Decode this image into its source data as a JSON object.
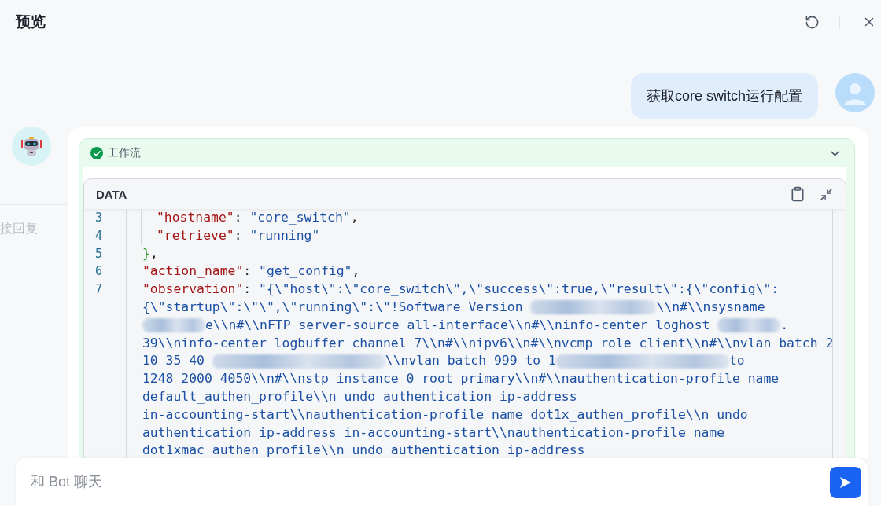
{
  "header": {
    "title": "预览"
  },
  "user_message": {
    "text": "获取core switch运行配置"
  },
  "side_note": {
    "text": "接回复"
  },
  "workflow": {
    "title": "工作流",
    "completed": true,
    "expanded": true,
    "code_panel": {
      "title": "DATA",
      "rows": [
        {
          "number": "3",
          "nested": true,
          "segments": [
            {
              "kind": "key",
              "text": "\"hostname\""
            },
            {
              "kind": "punct",
              "text": ": "
            },
            {
              "kind": "string",
              "text": "\"core_switch\""
            },
            {
              "kind": "punct",
              "text": ","
            }
          ]
        },
        {
          "number": "4",
          "nested": true,
          "segments": [
            {
              "kind": "key",
              "text": "\"retrieve\""
            },
            {
              "kind": "punct",
              "text": ": "
            },
            {
              "kind": "string",
              "text": "\"running\""
            }
          ]
        },
        {
          "number": "5",
          "nested": false,
          "segments": [
            {
              "kind": "brace",
              "text": "}"
            },
            {
              "kind": "punct",
              "text": ","
            }
          ]
        },
        {
          "number": "6",
          "nested": false,
          "segments": [
            {
              "kind": "key",
              "text": "\"action_name\""
            },
            {
              "kind": "punct",
              "text": ": "
            },
            {
              "kind": "string",
              "text": "\"get_config\""
            },
            {
              "kind": "punct",
              "text": ","
            }
          ]
        },
        {
          "number": "7",
          "nested": false,
          "segments": [
            {
              "kind": "key",
              "text": "\"observation\""
            },
            {
              "kind": "punct",
              "text": ": "
            },
            {
              "kind": "string",
              "text": "\"{\\\"host\\\":\\\"core_switch\\\",\\\"success\\\":true,\\\"result\\\":{\\\"config\\\":"
            }
          ]
        },
        {
          "nested": false,
          "segments": [
            {
              "kind": "string",
              "text": "{\\\"startup\\\":\\\"\\\",\\\"running\\\":\\\"!Software Version "
            },
            {
              "kind": "redacted_long"
            },
            {
              "kind": "string",
              "text": "\\\\n#\\\\nsysname"
            }
          ]
        },
        {
          "nested": false,
          "segments": [
            {
              "kind": "redacted_short"
            },
            {
              "kind": "string",
              "text": "e\\\\n#\\\\nFTP server-source all-interface\\\\n#\\\\ninfo-center loghost "
            },
            {
              "kind": "redacted_short"
            },
            {
              "kind": "string",
              "text": "."
            }
          ]
        },
        {
          "nested": false,
          "segments": [
            {
              "kind": "string",
              "text": "39\\\\ninfo-center logbuffer channel 7\\\\n#\\\\nipv6\\\\n#\\\\nvcmp role client\\\\n#\\\\nvlan batch 2"
            }
          ]
        },
        {
          "nested": false,
          "segments": [
            {
              "kind": "string",
              "text": "10 35 40 "
            },
            {
              "kind": "redacted_wide"
            },
            {
              "kind": "string",
              "text": "\\\\nvlan batch 999 to 1"
            },
            {
              "kind": "redacted_wide"
            },
            {
              "kind": "string",
              "text": "to"
            }
          ]
        },
        {
          "nested": false,
          "segments": [
            {
              "kind": "string",
              "text": "1248 2000 4050\\\\n#\\\\nstp instance 0 root primary\\\\n#\\\\nauthentication-profile name"
            }
          ]
        },
        {
          "nested": false,
          "segments": [
            {
              "kind": "string",
              "text": "default_authen_profile\\\\n undo authentication ip-address"
            }
          ]
        },
        {
          "nested": false,
          "segments": [
            {
              "kind": "string",
              "text": "in-accounting-start\\\\nauthentication-profile name dot1x_authen_profile\\\\n undo"
            }
          ]
        },
        {
          "nested": false,
          "segments": [
            {
              "kind": "string",
              "text": "authentication ip-address in-accounting-start\\\\nauthentication-profile name"
            }
          ]
        },
        {
          "nested": false,
          "segments": [
            {
              "kind": "string",
              "text": "dot1xmac_authen_profile\\\\n undo authentication ip-address"
            }
          ]
        }
      ]
    }
  },
  "composer": {
    "placeholder": "和 Bot 聊天"
  }
}
